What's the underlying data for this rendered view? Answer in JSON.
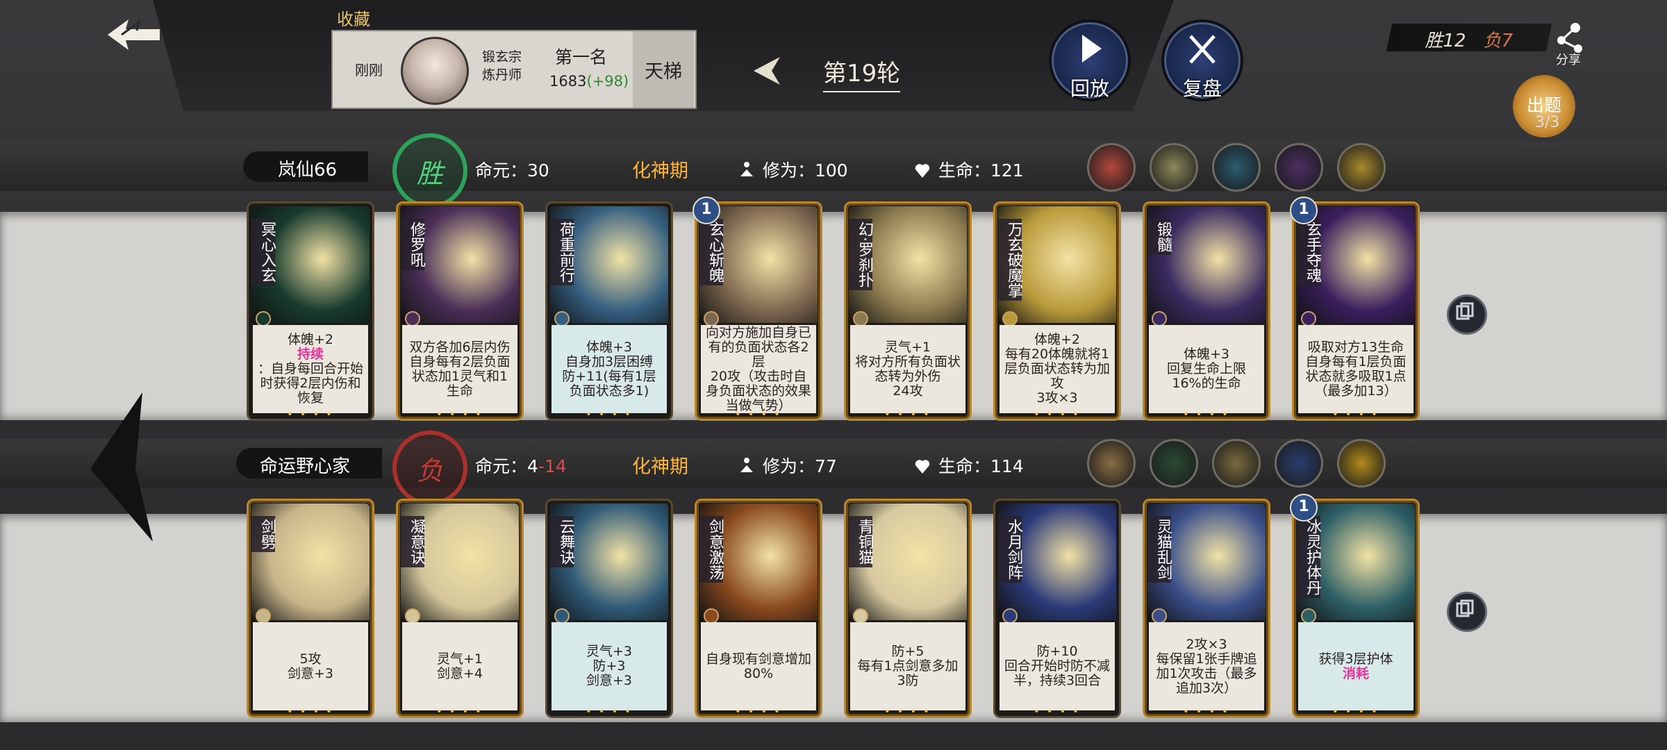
{
  "header": {
    "favorites_label": "收藏",
    "time": "刚刚",
    "sect": [
      "锻玄宗",
      "炼丹师"
    ],
    "rank": "第一名",
    "score": "1683",
    "score_delta": "(+98)",
    "mode": "天梯",
    "round": "第19轮",
    "replay_label": "回放",
    "review_label": "复盘",
    "record_win": "胜12",
    "record_lose": "负7",
    "share_label": "分享",
    "question_label": "出题",
    "question_count": "3/3"
  },
  "players": [
    {
      "name": "岚仙66",
      "result": "胜",
      "life_label": "命元：",
      "life_value": "30",
      "life_delta": "",
      "realm": "化神期",
      "cultivation": "修为：100",
      "hp": "生命：121",
      "avatar_colors": [
        "#b4483e",
        "#8c8a5a",
        "#2b5c70",
        "#4e2d63",
        "#a88a2c"
      ],
      "cards": [
        {
          "name": "冥心入玄",
          "desc": [
            [
              "体魄+2",
              ""
            ],
            [
              "持续",
              ""
            ],
            [
              "：自身每回合开始时获得2层内伤和恢复",
              ""
            ]
          ],
          "art": "#173a2e"
        },
        {
          "name": "修罗吼",
          "desc": [
            [
              "双方各加6层内伤",
              ""
            ],
            [
              "自身每有2层负面状态加1灵气和1生命",
              ""
            ]
          ],
          "art": "#4a2e57"
        },
        {
          "name": "荷重前行",
          "desc": [
            [
              "体魄+3",
              ""
            ],
            [
              "自身加3层困缚",
              ""
            ],
            [
              "防+11(每有1层负面状态多1)",
              ""
            ]
          ],
          "art": "#355f80"
        },
        {
          "name": "玄心斩魄",
          "level": "1",
          "desc": [
            [
              "向对方施加自身已有的负面状态各2层",
              ""
            ],
            [
              "20攻（攻击时自身负面状态的效果当做气势）",
              ""
            ]
          ],
          "art": "#7e6750"
        },
        {
          "name": "幻·罗刹扑",
          "desc": [
            [
              "灵气+1",
              ""
            ],
            [
              "将对方所有负面状态转为外伤",
              ""
            ],
            [
              "24攻",
              ""
            ]
          ],
          "art": "#8b7a4e"
        },
        {
          "name": "万玄破魔掌",
          "desc": [
            [
              "体魄+2",
              ""
            ],
            [
              "每有20体魄就将1层负面状态转为加攻",
              ""
            ],
            [
              "3攻×3",
              ""
            ]
          ],
          "art": "#b99a3a"
        },
        {
          "name": "锻髓",
          "desc": [
            [
              "体魄+3",
              ""
            ],
            [
              "回复生命上限16%的生命",
              ""
            ]
          ],
          "art": "#3b2b61"
        },
        {
          "name": "玄手夺魂",
          "level": "1",
          "desc": [
            [
              "吸取对方13生命",
              ""
            ],
            [
              "自身每有1层负面状态就多吸取1点（最多加13）",
              ""
            ]
          ],
          "art": "#3a1f5e"
        }
      ]
    },
    {
      "name": "命运野心家",
      "result": "负",
      "life_label": "命元：",
      "life_value": "4",
      "life_delta": "-14",
      "realm": "化神期",
      "cultivation": "修为：77",
      "hp": "生命：114",
      "avatar_colors": [
        "#8a6d44",
        "#2a4a35",
        "#7a6a3e",
        "#2a3e6e",
        "#b08a1a"
      ],
      "cards": [
        {
          "name": "剑劈",
          "desc": [
            [
              "5攻",
              ""
            ],
            [
              "剑意+3",
              ""
            ]
          ],
          "art": "#c8b58a"
        },
        {
          "name": "凝意诀",
          "desc": [
            [
              "灵气+1",
              ""
            ],
            [
              "剑意+4",
              ""
            ]
          ],
          "art": "#d4c69b"
        },
        {
          "name": "云舞诀",
          "desc": [
            [
              "灵气+3",
              ""
            ],
            [
              "防+3",
              ""
            ],
            [
              "剑意+3",
              ""
            ]
          ],
          "art": "#2f5a77"
        },
        {
          "name": "剑意激荡",
          "desc": [
            [
              "自身现有剑意增加80%",
              ""
            ]
          ],
          "art": "#8a4a1e"
        },
        {
          "name": "青铜猫",
          "desc": [
            [
              "防+5",
              ""
            ],
            [
              "每有1点剑意多加3防",
              ""
            ]
          ],
          "art": "#d7c9a0"
        },
        {
          "name": "水月剑阵",
          "desc": [
            [
              "防+10",
              ""
            ],
            [
              "回合开始时防不减半，持续3回合",
              ""
            ]
          ],
          "art": "#2b3a78"
        },
        {
          "name": "灵猫乱剑",
          "desc": [
            [
              "2攻×3",
              ""
            ],
            [
              "每保留1张手牌追加1次攻击（最多追加3次）",
              ""
            ]
          ],
          "art": "#3a4f8a"
        },
        {
          "name": "冰灵护体丹",
          "level": "1",
          "desc": [
            [
              "获得3层护体",
              ""
            ],
            [
              "消耗",
              ""
            ]
          ],
          "art": "#2d5f66"
        }
      ]
    }
  ]
}
